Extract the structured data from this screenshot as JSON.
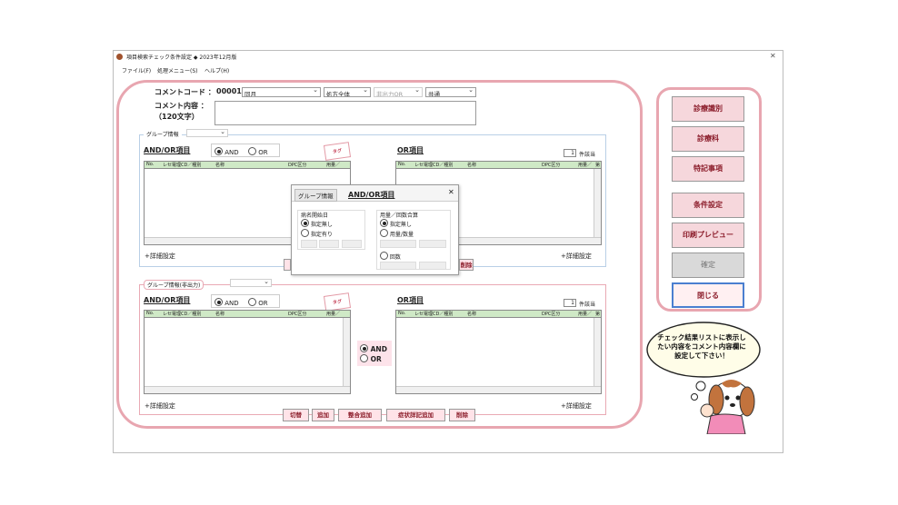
{
  "window": {
    "title": "項目検索チェック条件設定 ◆ 2023年12月版",
    "close_glyph": "✕"
  },
  "menu": [
    "ファイル(F)",
    "処理メニュー(S)",
    "ヘルプ(H)"
  ],
  "comment": {
    "code_label": "コメントコード ：",
    "code_value": "00001",
    "dropdown1": "同月",
    "dropdown2": "処方全体",
    "dropdown3": "非出力OR",
    "dropdown4": "共通",
    "content_label_1": "コメント内容 ：",
    "content_label_2": "（120文字）",
    "content_value": ""
  },
  "top_group": {
    "tag": "グループ情報",
    "andor_title": "AND/OR項目",
    "radio_and": "AND",
    "radio_or": "OR",
    "or_title": "OR項目",
    "count_value": "1",
    "count_unit": "件該当",
    "detail_left": "+詳細設定",
    "detail_right": "+詳細設定"
  },
  "table_headers": [
    "No.",
    "レセ電理CD／種別",
    "名称",
    "DPC区分",
    "用量／",
    "第"
  ],
  "popup": {
    "tab1": "グループ情報",
    "tab2": "AND/OR項目",
    "close": "✕",
    "left_title": "病名開始日",
    "left_opt1": "指定無し",
    "left_opt2": "指定有り",
    "right_title": "用量／回数合算",
    "right_opt1": "指定無し",
    "right_opt2": "用量/数量",
    "right_opt3": "回数"
  },
  "bottom_group": {
    "tag": "グループ情報(非出力)",
    "andor_title": "AND/OR項目",
    "radio_and": "AND",
    "radio_or": "OR",
    "or_title": "OR項目",
    "count_value": "1",
    "count_unit": "件該当",
    "detail_left": "+詳細設定",
    "detail_right": "+詳細設定",
    "mid_and": "AND",
    "mid_or": "OR"
  },
  "bottom_buttons": [
    "切替",
    "追加",
    "整合追加",
    "症状詳記追加",
    "削除"
  ],
  "side_buttons": [
    "診療識別",
    "診療科",
    "特記事項",
    "条件設定",
    "印刷プレビュー",
    "確定",
    "閉じる"
  ],
  "speech": "チェック結果リストに表示したい内容をコメント内容欄に設定して下さい！"
}
